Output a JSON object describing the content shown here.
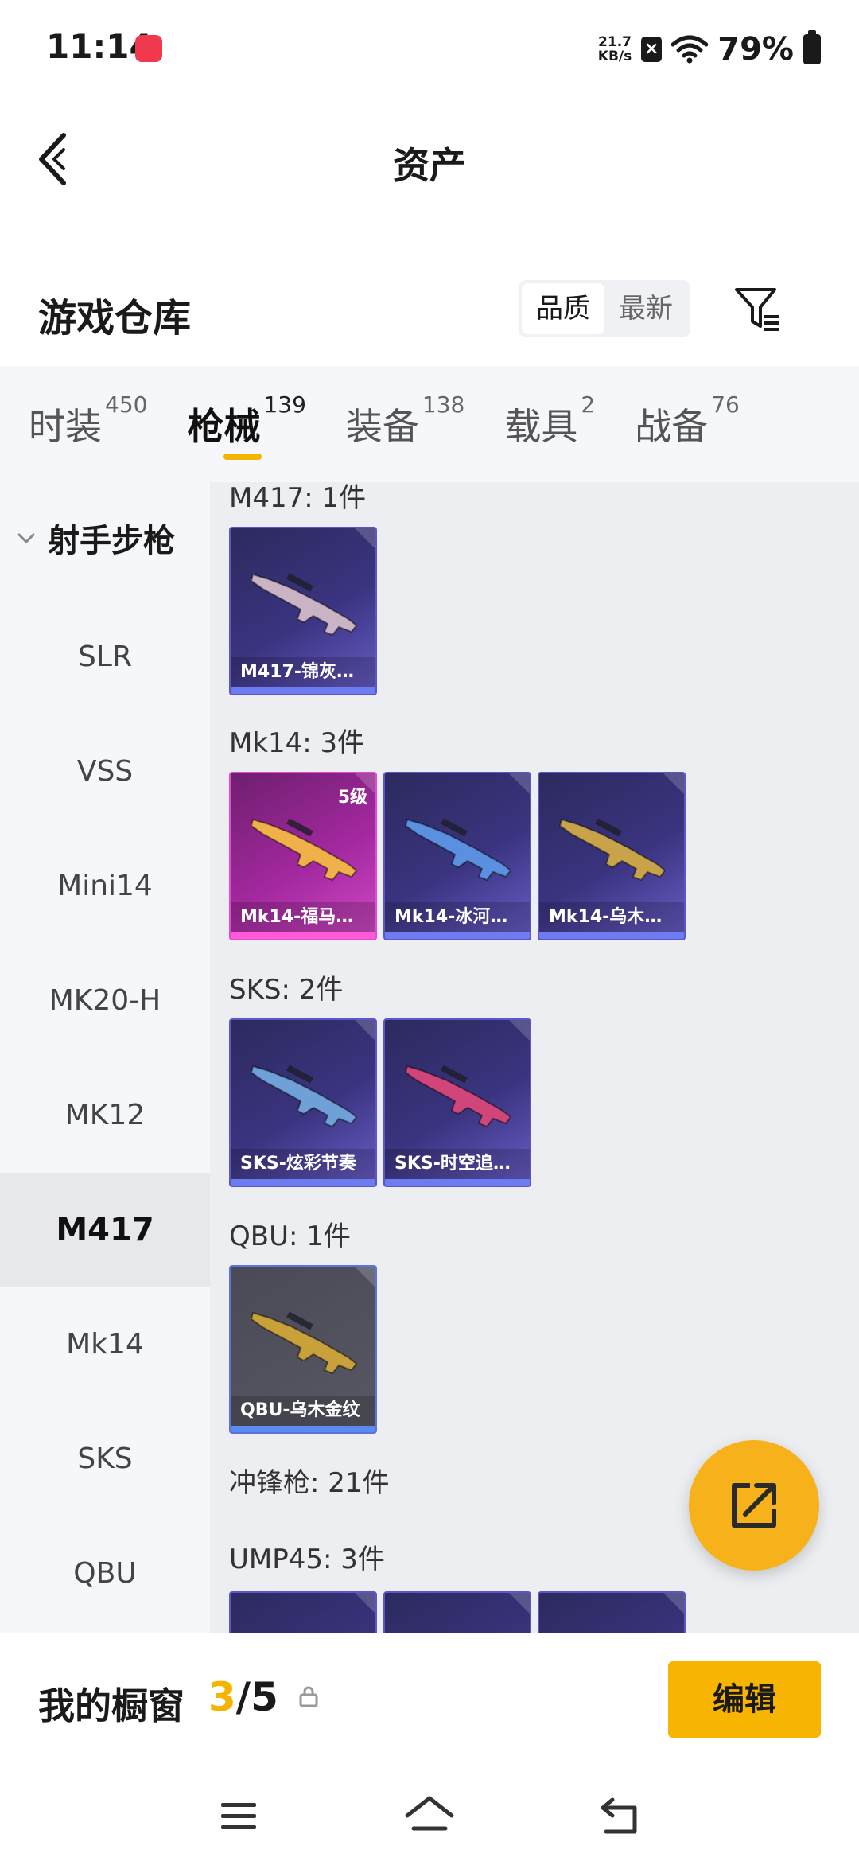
{
  "status_bar": {
    "time": "11:14",
    "net_speed_value": "21.7",
    "net_speed_unit": "KB/s",
    "battery": "79%"
  },
  "header": {
    "title": "资产"
  },
  "warehouse": {
    "title": "游戏仓库",
    "sort_options": [
      "品质",
      "最新"
    ],
    "active_sort": "品质"
  },
  "tabs": [
    {
      "label": "时装",
      "count": "450"
    },
    {
      "label": "枪械",
      "count": "139"
    },
    {
      "label": "装备",
      "count": "138"
    },
    {
      "label": "载具",
      "count": "2"
    },
    {
      "label": "战备",
      "count": "76"
    }
  ],
  "active_tab": "枪械",
  "sidebar": {
    "group": "射手步枪",
    "items": [
      "SLR",
      "VSS",
      "Mini14",
      "MK20-H",
      "MK12",
      "M417",
      "Mk14",
      "SKS",
      "QBU"
    ],
    "active": "M417"
  },
  "sections": [
    {
      "label": "M417: 1件",
      "cards": [
        {
          "name": "M417-锦灰…",
          "style": "purple",
          "gun_color": "#c9b3c4"
        }
      ]
    },
    {
      "label": "Mk14: 3件",
      "cards": [
        {
          "name": "Mk14-福马…",
          "style": "pink",
          "level": "5级",
          "gun_color": "#f0b04a"
        },
        {
          "name": "Mk14-冰河…",
          "style": "purple",
          "gun_color": "#5b8fe0"
        },
        {
          "name": "Mk14-乌木…",
          "style": "purple",
          "gun_color": "#c9a34a"
        }
      ]
    },
    {
      "label": "SKS: 2件",
      "cards": [
        {
          "name": "SKS-炫彩节奏",
          "style": "purple",
          "gun_color": "#6fa0d8"
        },
        {
          "name": "SKS-时空追…",
          "style": "purple",
          "gun_color": "#d0467a"
        }
      ]
    },
    {
      "label": "QBU: 1件",
      "cards": [
        {
          "name": "QBU-乌木金纹",
          "style": "grey",
          "gun_color": "#c9a13a"
        }
      ]
    },
    {
      "label": "冲锋枪: 21件",
      "cards": []
    },
    {
      "label": "UMP45: 3件",
      "cards": [
        {
          "name": "",
          "style": "purple",
          "gun_color": "#e2a23a"
        },
        {
          "name": "",
          "style": "purple",
          "gun_color": "#d06a3a"
        },
        {
          "name": "",
          "style": "purple",
          "gun_color": "#c06aa0"
        }
      ]
    }
  ],
  "showcase": {
    "title": "我的橱窗",
    "current": "3",
    "separator": "/",
    "total": "5",
    "edit_label": "编辑"
  },
  "colors": {
    "accent": "#f5b400",
    "fab": "#f7b21b"
  }
}
